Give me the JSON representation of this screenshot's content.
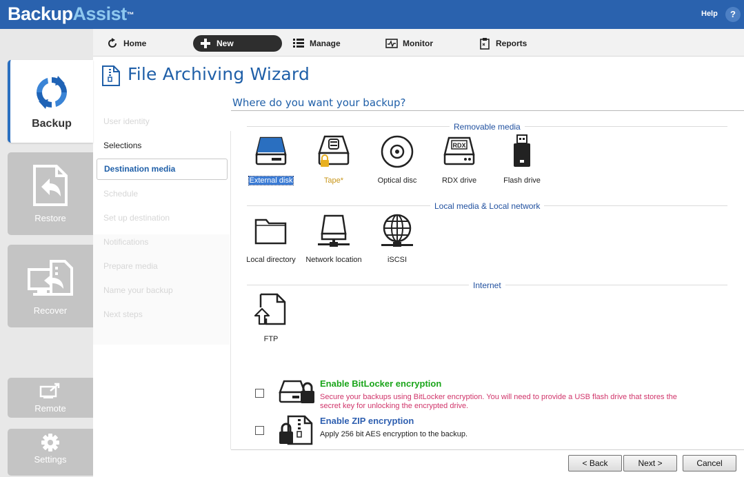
{
  "app": {
    "brand_part1": "Backup",
    "brand_part2": "Assist",
    "brand_tm": "™",
    "help_label": "Help",
    "help_icon_text": "?"
  },
  "rail": {
    "items": [
      {
        "label": "Backup",
        "icon": "backup-sync-icon",
        "active": true
      },
      {
        "label": "Restore",
        "icon": "restore-file-icon"
      },
      {
        "label": "Recover",
        "icon": "recover-monitor-icon"
      },
      {
        "label": "Remote",
        "icon": "remote-icon"
      },
      {
        "label": "Settings",
        "icon": "gear-icon"
      }
    ]
  },
  "nav": {
    "home": "Home",
    "new": "New",
    "manage": "Manage",
    "monitor": "Monitor",
    "reports": "Reports"
  },
  "wizard": {
    "title": "File Archiving Wizard",
    "question": "Where do you want your backup?",
    "steps": [
      {
        "label": "User identity",
        "state": "disabled"
      },
      {
        "label": "Selections",
        "state": "done"
      },
      {
        "label": "Destination media",
        "state": "current"
      },
      {
        "label": "Schedule",
        "state": "disabled"
      },
      {
        "label": "Set up destination",
        "state": "disabled"
      },
      {
        "label": "Notifications",
        "state": "disabled"
      },
      {
        "label": "Prepare media",
        "state": "disabled"
      },
      {
        "label": "Name your backup",
        "state": "disabled"
      },
      {
        "label": "Next steps",
        "state": "disabled"
      }
    ]
  },
  "groups": {
    "removable": {
      "title": "Removable media",
      "items": [
        {
          "label": "External disk",
          "icon": "external-disk-icon",
          "selected": true
        },
        {
          "label": "Tape*",
          "icon": "tape-icon"
        },
        {
          "label": "Optical disc",
          "icon": "optical-disc-icon"
        },
        {
          "label": "RDX drive",
          "icon": "rdx-drive-icon",
          "icon_text": "RDX"
        },
        {
          "label": "Flash drive",
          "icon": "flash-drive-icon"
        }
      ]
    },
    "local": {
      "title": "Local media & Local network",
      "items": [
        {
          "label": "Local directory",
          "icon": "folder-icon"
        },
        {
          "label": "Network location",
          "icon": "network-location-icon"
        },
        {
          "label": "iSCSI",
          "icon": "iscsi-globe-icon"
        }
      ]
    },
    "internet": {
      "title": "Internet",
      "items": [
        {
          "label": "FTP",
          "icon": "ftp-upload-icon"
        }
      ]
    }
  },
  "encryption": {
    "bitlocker": {
      "title": "Enable BitLocker encryption",
      "desc_line1": "Secure your backups using BitLocker encryption. You will need to provide a USB flash drive that stores the",
      "desc_line2": "secret key for unlocking the encrypted drive.",
      "checked": false,
      "title_color": "#1aa51a",
      "desc_color": "#d0346a"
    },
    "zip": {
      "title": "Enable ZIP encryption",
      "desc": "Apply 256 bit AES encryption to the backup.",
      "checked": false,
      "title_color": "#2e5fb0"
    }
  },
  "buttons": {
    "back": "< Back",
    "next": "Next >",
    "cancel": "Cancel"
  },
  "colors": {
    "topbar": "#2a62ae",
    "accent": "#1f5fa8"
  }
}
